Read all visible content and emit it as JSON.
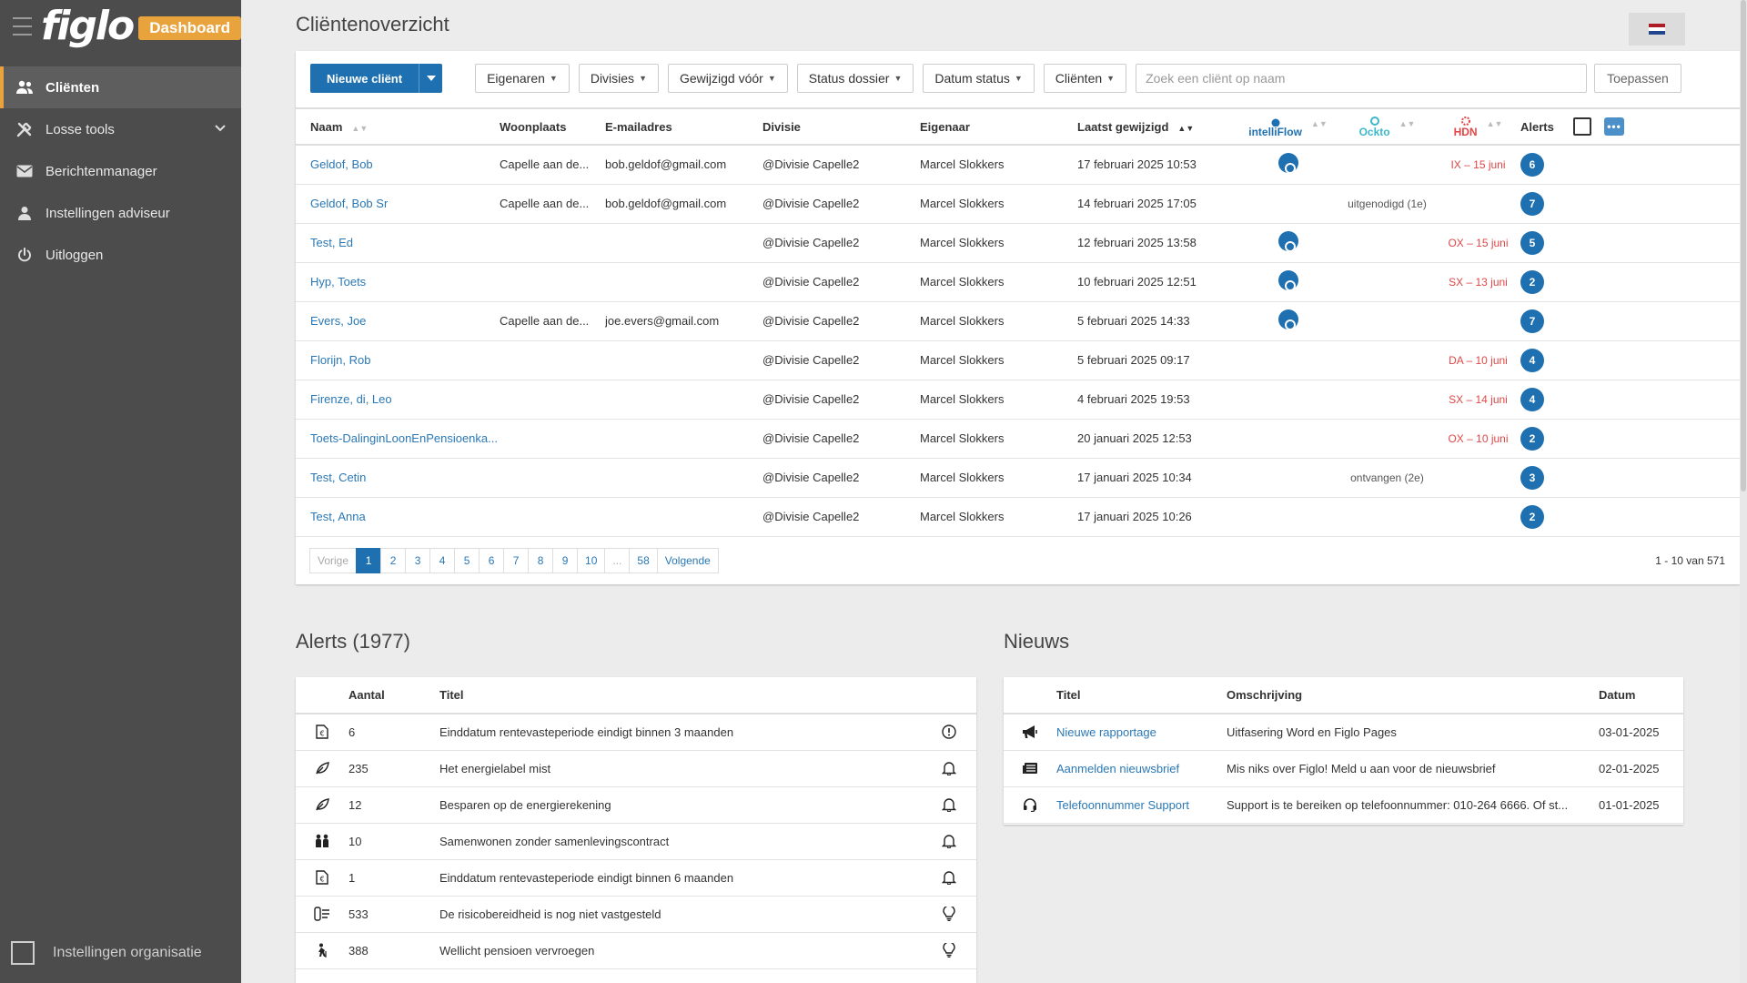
{
  "sidebar": {
    "logo": "figlo",
    "badge": "Dashboard",
    "items": [
      {
        "label": "Cliënten",
        "icon": "users-icon"
      },
      {
        "label": "Losse tools",
        "icon": "tools-icon"
      },
      {
        "label": "Berichtenmanager",
        "icon": "envelope-icon"
      },
      {
        "label": "Instellingen adviseur",
        "icon": "user-icon"
      },
      {
        "label": "Uitloggen",
        "icon": "power-icon"
      }
    ],
    "bottom_label": "Instellingen organisatie"
  },
  "page": {
    "title": "Cliëntenoverzicht",
    "flag_colors": [
      "#ae1c28",
      "#ffffff",
      "#21468b"
    ]
  },
  "toolbar": {
    "new_client": "Nieuwe cliënt",
    "filters": [
      "Eigenaren",
      "Divisies",
      "Gewijzigd vóór",
      "Status dossier",
      "Datum status",
      "Cliënten"
    ],
    "search_placeholder": "Zoek een cliënt op naam",
    "apply": "Toepassen"
  },
  "clients_table": {
    "headers": {
      "naam": "Naam",
      "woonplaats": "Woonplaats",
      "email": "E-mailadres",
      "divisie": "Divisie",
      "eigenaar": "Eigenaar",
      "laatst": "Laatst gewijzigd",
      "intelliflow": "intelliFlow",
      "ockto": "Ockto",
      "hdn": "HDN",
      "alerts": "Alerts"
    },
    "rows": [
      {
        "naam": "Geldof, Bob",
        "woonplaats": "Capelle aan de...",
        "email": "bob.geldof@gmail.com",
        "divisie": "@Divisie Capelle2",
        "eigenaar": "Marcel Slokkers",
        "laatst": "17 februari 2025 10:53",
        "intelliflow": true,
        "ockto": "",
        "hdn": "IX – 15 juni",
        "alerts": "6"
      },
      {
        "naam": "Geldof, Bob Sr",
        "woonplaats": "Capelle aan de...",
        "email": "bob.geldof@gmail.com",
        "divisie": "@Divisie Capelle2",
        "eigenaar": "Marcel Slokkers",
        "laatst": "14 februari 2025 17:05",
        "intelliflow": false,
        "ockto": "uitgenodigd (1e)",
        "hdn": "",
        "alerts": "7"
      },
      {
        "naam": "Test, Ed",
        "woonplaats": "",
        "email": "",
        "divisie": "@Divisie Capelle2",
        "eigenaar": "Marcel Slokkers",
        "laatst": "12 februari 2025 13:58",
        "intelliflow": true,
        "ockto": "",
        "hdn": "OX – 15 juni",
        "alerts": "5"
      },
      {
        "naam": "Hyp, Toets",
        "woonplaats": "",
        "email": "",
        "divisie": "@Divisie Capelle2",
        "eigenaar": "Marcel Slokkers",
        "laatst": "10 februari 2025 12:51",
        "intelliflow": true,
        "ockto": "",
        "hdn": "SX – 13 juni",
        "alerts": "2"
      },
      {
        "naam": "Evers, Joe",
        "woonplaats": "Capelle aan de...",
        "email": "joe.evers@gmail.com",
        "divisie": "@Divisie Capelle2",
        "eigenaar": "Marcel Slokkers",
        "laatst": "5 februari 2025 14:33",
        "intelliflow": true,
        "ockto": "",
        "hdn": "",
        "alerts": "7"
      },
      {
        "naam": "Florijn, Rob",
        "woonplaats": "",
        "email": "",
        "divisie": "@Divisie Capelle2",
        "eigenaar": "Marcel Slokkers",
        "laatst": "5 februari 2025 09:17",
        "intelliflow": false,
        "ockto": "",
        "hdn": "DA – 10 juni",
        "alerts": "4"
      },
      {
        "naam": "Firenze, di, Leo",
        "woonplaats": "",
        "email": "",
        "divisie": "@Divisie Capelle2",
        "eigenaar": "Marcel Slokkers",
        "laatst": "4 februari 2025 19:53",
        "intelliflow": false,
        "ockto": "",
        "hdn": "SX – 14 juni",
        "alerts": "4"
      },
      {
        "naam": "Toets-DalinginLoonEnPensioenka...",
        "woonplaats": "",
        "email": "",
        "divisie": "@Divisie Capelle2",
        "eigenaar": "Marcel Slokkers",
        "laatst": "20 januari 2025 12:53",
        "intelliflow": false,
        "ockto": "",
        "hdn": "OX – 10 juni",
        "alerts": "2"
      },
      {
        "naam": "Test, Cetin",
        "woonplaats": "",
        "email": "",
        "divisie": "@Divisie Capelle2",
        "eigenaar": "Marcel Slokkers",
        "laatst": "17 januari 2025 10:34",
        "intelliflow": false,
        "ockto": "ontvangen (2e)",
        "hdn": "",
        "alerts": "3"
      },
      {
        "naam": "Test, Anna",
        "woonplaats": "",
        "email": "",
        "divisie": "@Divisie Capelle2",
        "eigenaar": "Marcel Slokkers",
        "laatst": "17 januari 2025 10:26",
        "intelliflow": false,
        "ockto": "",
        "hdn": "",
        "alerts": "2"
      }
    ]
  },
  "pagination": {
    "prev": "Vorige",
    "pages": [
      "1",
      "2",
      "3",
      "4",
      "5",
      "6",
      "7",
      "8",
      "9",
      "10",
      "...",
      "58"
    ],
    "current": "1",
    "next": "Volgende",
    "info": "1 - 10 van 571"
  },
  "alerts": {
    "title": "Alerts (1977)",
    "headers": {
      "aantal": "Aantal",
      "titel": "Titel"
    },
    "rows": [
      {
        "icon": "document-euro-icon",
        "aantal": "6",
        "titel": "Einddatum rentevasteperiode eindigt binnen 3 maanden",
        "status_icon": "exclamation-circle-icon"
      },
      {
        "icon": "leaf-icon",
        "aantal": "235",
        "titel": "Het energielabel mist",
        "status_icon": "bell-icon"
      },
      {
        "icon": "leaf-icon",
        "aantal": "12",
        "titel": "Besparen op de energierekening",
        "status_icon": "bell-icon"
      },
      {
        "icon": "people-icon",
        "aantal": "10",
        "titel": "Samenwonen zonder samenlevingscontract",
        "status_icon": "bell-icon"
      },
      {
        "icon": "document-euro-icon",
        "aantal": "1",
        "titel": "Einddatum rentevasteperiode eindigt binnen 6 maanden",
        "status_icon": "bell-icon"
      },
      {
        "icon": "gauge-icon",
        "aantal": "533",
        "titel": "De risicobereidheid is nog niet vastgesteld",
        "status_icon": "lightbulb-icon"
      },
      {
        "icon": "person-cane-icon",
        "aantal": "388",
        "titel": "Wellicht pensioen vervroegen",
        "status_icon": "lightbulb-icon"
      }
    ]
  },
  "news": {
    "title": "Nieuws",
    "headers": {
      "titel": "Titel",
      "omschrijving": "Omschrijving",
      "datum": "Datum"
    },
    "rows": [
      {
        "icon": "megaphone-icon",
        "titel": "Nieuwe rapportage",
        "omschrijving": "Uitfasering Word en Figlo Pages",
        "datum": "03-01-2025"
      },
      {
        "icon": "newspaper-icon",
        "titel": "Aanmelden nieuwsbrief",
        "omschrijving": "Mis niks over Figlo! Meld u aan voor de nieuwsbrief",
        "datum": "02-01-2025"
      },
      {
        "icon": "headset-icon",
        "titel": "Telefoonnummer Support",
        "omschrijving": "Support is te bereiken op telefoonnummer: 010-264 6666. Of st...",
        "datum": "01-01-2025"
      }
    ]
  }
}
